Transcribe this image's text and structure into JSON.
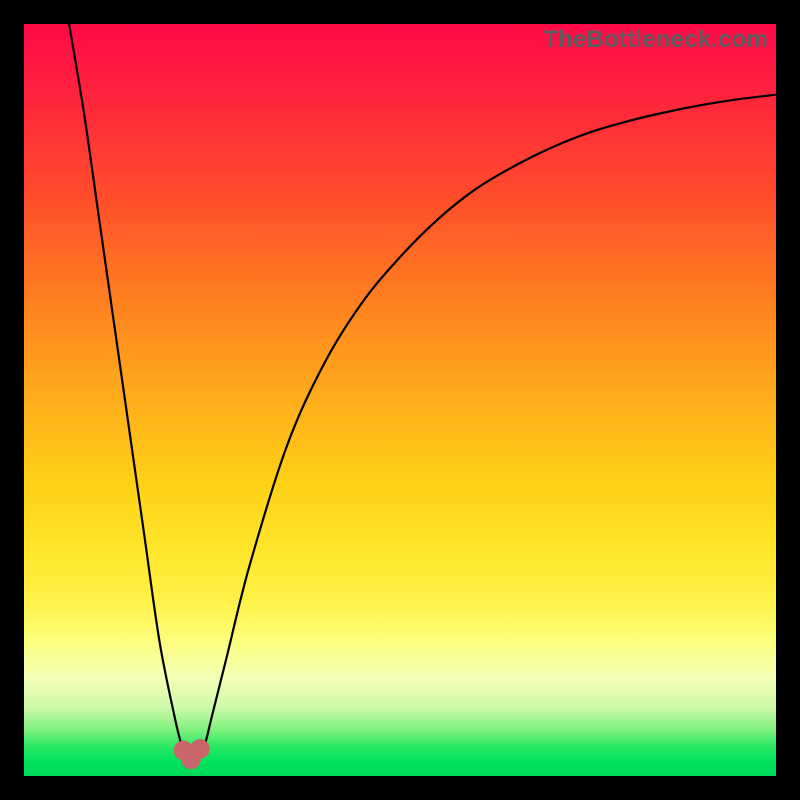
{
  "watermark": "TheBottleneck.com",
  "chart_data": {
    "type": "line",
    "title": "",
    "xlabel": "",
    "ylabel": "",
    "xlim": [
      0,
      100
    ],
    "ylim": [
      0,
      100
    ],
    "grid": false,
    "legend": false,
    "series": [
      {
        "name": "curve",
        "x": [
          6,
          8,
          10,
          12,
          14,
          16,
          18,
          20,
          21,
          22,
          23,
          24,
          25,
          27,
          30,
          35,
          40,
          45,
          50,
          55,
          60,
          65,
          70,
          75,
          80,
          85,
          90,
          95,
          100
        ],
        "y": [
          100,
          88,
          74,
          60,
          46,
          32,
          18,
          8,
          4,
          2,
          2,
          4,
          8,
          16,
          28,
          44,
          55,
          63,
          69,
          74,
          78,
          81,
          83.5,
          85.5,
          87,
          88.2,
          89.2,
          90,
          90.6
        ]
      }
    ],
    "markers": [
      {
        "name": "valley-left",
        "x": 21.2,
        "y": 3.4,
        "r": 1.3,
        "color": "#c9666b"
      },
      {
        "name": "valley-mid",
        "x": 22.2,
        "y": 2.2,
        "r": 1.3,
        "color": "#c9666b"
      },
      {
        "name": "valley-right",
        "x": 23.4,
        "y": 3.6,
        "r": 1.3,
        "color": "#c9666b"
      }
    ],
    "gradient_stops": [
      {
        "pos": 0,
        "color": "#ff0a47"
      },
      {
        "pos": 50,
        "color": "#ffd015"
      },
      {
        "pos": 82,
        "color": "#fcff7c"
      },
      {
        "pos": 100,
        "color": "#00da5b"
      }
    ]
  }
}
